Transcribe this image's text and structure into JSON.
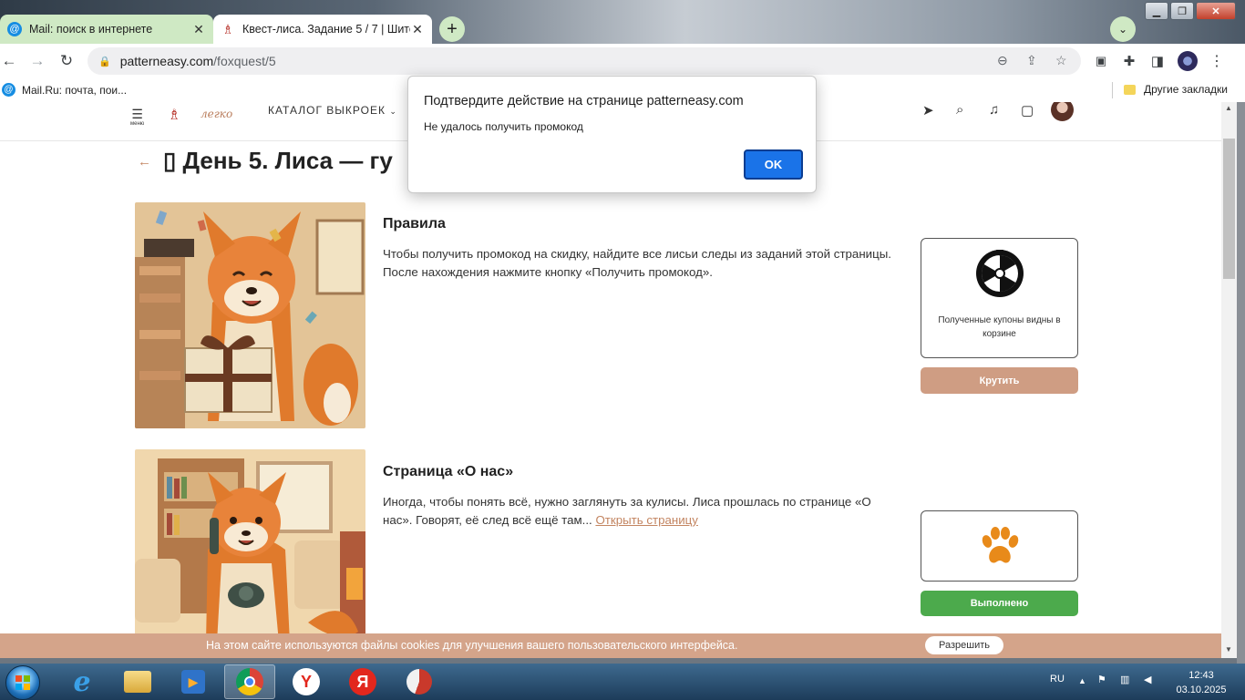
{
  "browser": {
    "tabs": [
      {
        "title": "Mail: поиск в интернете",
        "favicon": "at-icon",
        "active": false
      },
      {
        "title": "Квест-лиса. Задание 5 / 7 | Шито",
        "favicon": "dress-icon",
        "active": true
      }
    ],
    "url": {
      "host": "patterneasy.com",
      "path": "/foxquest/5"
    },
    "bookmarks": [
      {
        "label": "Mail.Ru: почта, пои..."
      },
      {
        "label": "Другие закладки"
      }
    ]
  },
  "site": {
    "menu_label": "меню",
    "logo_text": "легко",
    "catalog_label": "КАТАЛОГ ВЫКРОЕК",
    "page_title": "▯ День 5. Лиса — гу"
  },
  "tasks": [
    {
      "title": "Правила",
      "text": "Чтобы получить промокод на скидку, найдите все лисьи следы из заданий этой страницы. После нахождения нажмите кнопку «Получить промокод»."
    },
    {
      "title": "Страница «О нас»",
      "text": "Иногда, чтобы понять всё, нужно заглянуть за кулисы. Лиса прошлась по странице «О нас». Говорят, её след всё ещё там...",
      "link_text": "Открыть страницу"
    }
  ],
  "reward": {
    "caption": "Полученные купоны видны в корзине",
    "spin_label": "Крутить",
    "done_label": "Выполнено",
    "paw_color": "#e88a1a"
  },
  "cookie": {
    "text": "На этом сайте используются файлы cookies для улучшения вашего пользовательского интерфейса.",
    "button": "Разрешить"
  },
  "dialog": {
    "title": "Подтвердите действие на странице patterneasy.com",
    "message": "Не удалось получить промокод",
    "ok": "OK"
  },
  "taskbar": {
    "language": "RU",
    "time": "12:43",
    "date": "03.10.2025"
  }
}
